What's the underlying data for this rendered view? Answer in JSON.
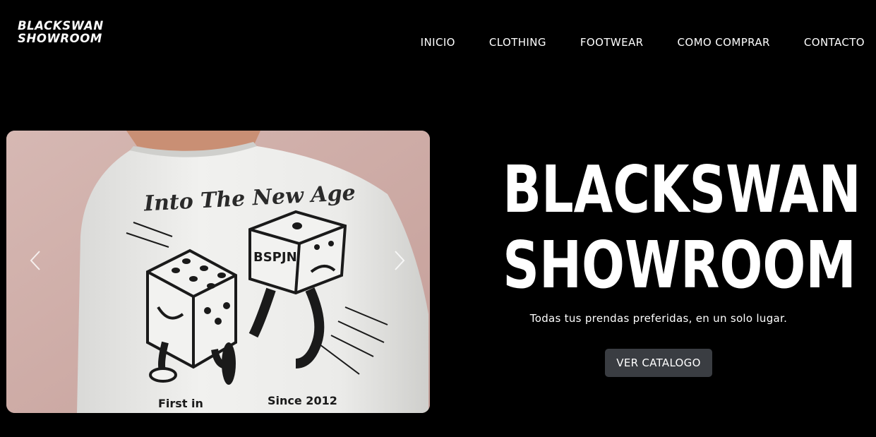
{
  "brand": {
    "line1": "BLACKSWAN",
    "line2": "SHOWROOM"
  },
  "nav": {
    "items": [
      {
        "label": "INICIO"
      },
      {
        "label": "CLOTHING"
      },
      {
        "label": "FOOTWEAR"
      },
      {
        "label": "COMO COMPRAR"
      },
      {
        "label": "CONTACTO"
      }
    ]
  },
  "carousel": {
    "shirt_header": "Into The New Age",
    "dice_label": "BSPJN",
    "shirt_footer_left": "First in",
    "shirt_footer_right": "Since 2012"
  },
  "hero": {
    "title_line1": "BLACKSWAN",
    "title_line2": "SHOWROOM",
    "subtitle": "Todas tus prendas preferidas, en un solo lugar.",
    "cta_label": "VER CATALOGO"
  },
  "colors": {
    "background": "#000000",
    "text": "#ffffff",
    "button": "#3a3d42"
  }
}
